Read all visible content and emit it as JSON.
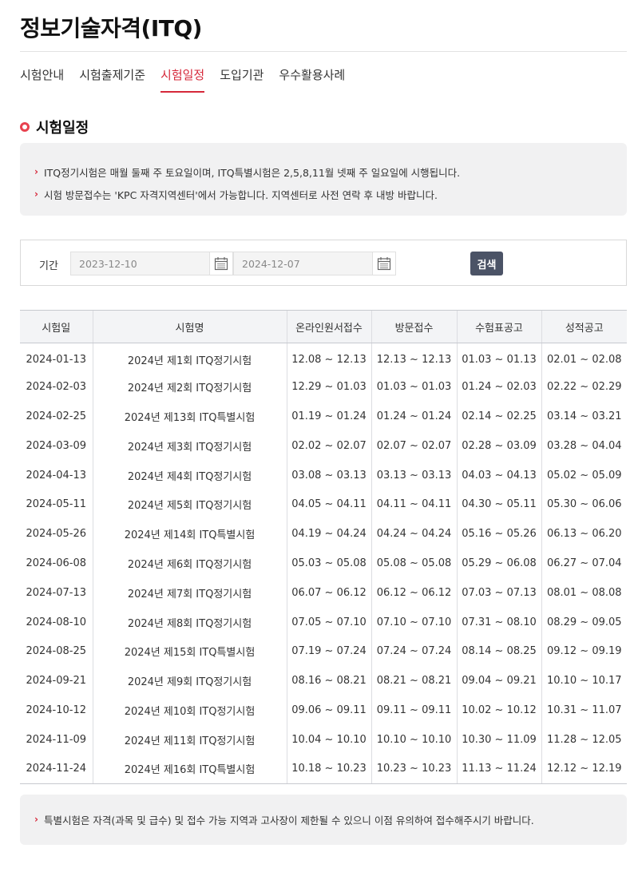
{
  "page": {
    "title": "정보기술자격(ITQ)"
  },
  "tabs": [
    {
      "label": "시험안내",
      "active": false
    },
    {
      "label": "시험출제기준",
      "active": false
    },
    {
      "label": "시험일정",
      "active": true
    },
    {
      "label": "도입기관",
      "active": false
    },
    {
      "label": "우수활용사례",
      "active": false
    }
  ],
  "section": {
    "title": "시험일정"
  },
  "notice_top": [
    "ITQ정기시험은 매월 둘째 주 토요일이며, ITQ특별시험은 2,5,8,11월 넷째 주 일요일에 시행됩니다.",
    "시험 방문접수는 'KPC 자격지역센터'에서 가능합니다. 지역센터로 사전 연락 후 내방 바랍니다."
  ],
  "filter": {
    "label": "기간",
    "start_date": "2023-12-10",
    "end_date": "2024-12-07",
    "search_label": "검색"
  },
  "table": {
    "headers": [
      "시험일",
      "시험명",
      "온라인원서접수",
      "방문접수",
      "수험표공고",
      "성적공고"
    ],
    "rows": [
      [
        "2024-01-13",
        "2024년 제1회 ITQ정기시험",
        "12.08 ~ 12.13",
        "12.13 ~ 12.13",
        "01.03 ~ 01.13",
        "02.01 ~ 02.08"
      ],
      [
        "2024-02-03",
        "2024년 제2회 ITQ정기시험",
        "12.29 ~ 01.03",
        "01.03 ~ 01.03",
        "01.24 ~ 02.03",
        "02.22 ~ 02.29"
      ],
      [
        "2024-02-25",
        "2024년 제13회 ITQ특별시험",
        "01.19 ~ 01.24",
        "01.24 ~ 01.24",
        "02.14 ~ 02.25",
        "03.14 ~ 03.21"
      ],
      [
        "2024-03-09",
        "2024년 제3회 ITQ정기시험",
        "02.02 ~ 02.07",
        "02.07 ~ 02.07",
        "02.28 ~ 03.09",
        "03.28 ~ 04.04"
      ],
      [
        "2024-04-13",
        "2024년 제4회 ITQ정기시험",
        "03.08 ~ 03.13",
        "03.13 ~ 03.13",
        "04.03 ~ 04.13",
        "05.02 ~ 05.09"
      ],
      [
        "2024-05-11",
        "2024년 제5회 ITQ정기시험",
        "04.05 ~ 04.11",
        "04.11 ~ 04.11",
        "04.30 ~ 05.11",
        "05.30 ~ 06.06"
      ],
      [
        "2024-05-26",
        "2024년 제14회 ITQ특별시험",
        "04.19 ~ 04.24",
        "04.24 ~ 04.24",
        "05.16 ~ 05.26",
        "06.13 ~ 06.20"
      ],
      [
        "2024-06-08",
        "2024년 제6회 ITQ정기시험",
        "05.03 ~ 05.08",
        "05.08 ~ 05.08",
        "05.29 ~ 06.08",
        "06.27 ~ 07.04"
      ],
      [
        "2024-07-13",
        "2024년 제7회 ITQ정기시험",
        "06.07 ~ 06.12",
        "06.12 ~ 06.12",
        "07.03 ~ 07.13",
        "08.01 ~ 08.08"
      ],
      [
        "2024-08-10",
        "2024년 제8회 ITQ정기시험",
        "07.05 ~ 07.10",
        "07.10 ~ 07.10",
        "07.31 ~ 08.10",
        "08.29 ~ 09.05"
      ],
      [
        "2024-08-25",
        "2024년 제15회 ITQ특별시험",
        "07.19 ~ 07.24",
        "07.24 ~ 07.24",
        "08.14 ~ 08.25",
        "09.12 ~ 09.19"
      ],
      [
        "2024-09-21",
        "2024년 제9회 ITQ정기시험",
        "08.16 ~ 08.21",
        "08.21 ~ 08.21",
        "09.04 ~ 09.21",
        "10.10 ~ 10.17"
      ],
      [
        "2024-10-12",
        "2024년 제10회 ITQ정기시험",
        "09.06 ~ 09.11",
        "09.11 ~ 09.11",
        "10.02 ~ 10.12",
        "10.31 ~ 11.07"
      ],
      [
        "2024-11-09",
        "2024년 제11회 ITQ정기시험",
        "10.04 ~ 10.10",
        "10.10 ~ 10.10",
        "10.30 ~ 11.09",
        "11.28 ~ 12.05"
      ],
      [
        "2024-11-24",
        "2024년 제16회 ITQ특별시험",
        "10.18 ~ 10.23",
        "10.23 ~ 10.23",
        "11.13 ~ 11.24",
        "12.12 ~ 12.19"
      ]
    ]
  },
  "notice_bottom": [
    "특별시험은 자격(과목 및 급수) 및 접수 가능 지역과 고사장이 제한될 수 있으니 이점 유의하여 접수해주시기 바랍니다."
  ],
  "icons": {
    "bullet": "ring-bullet-icon",
    "chevron": "chevron-right-icon",
    "calendar": "calendar-icon"
  },
  "colors": {
    "accent": "#d6283a",
    "bullet": "#e8424f",
    "button": "#4b5366",
    "notice_bg": "#f1f1f2",
    "header_bg": "#f3f4f6"
  }
}
